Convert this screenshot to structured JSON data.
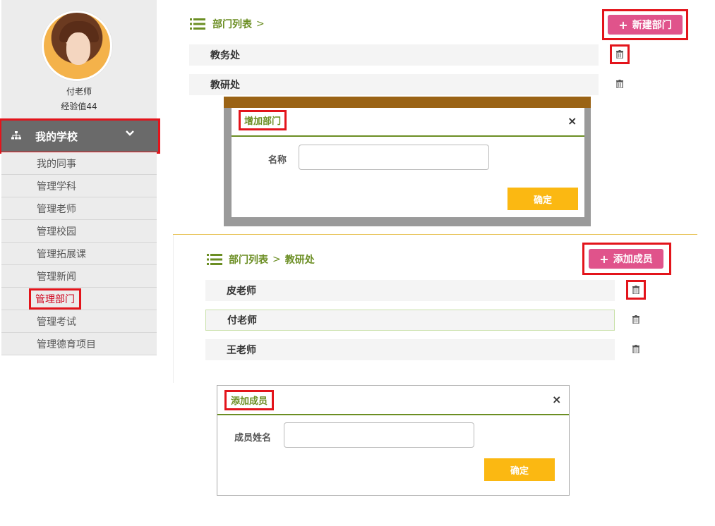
{
  "sidebar": {
    "teacher_name": "付老师",
    "experience": "经验值44",
    "school_menu": "我的学校",
    "items": [
      "我的同事",
      "管理学科",
      "管理老师",
      "管理校园",
      "管理拓展课",
      "管理新闻",
      "管理部门",
      "管理考试",
      "管理德育项目"
    ],
    "active_item": "管理部门"
  },
  "dept_panel": {
    "breadcrumb": "部门列表",
    "new_button": "新建部门",
    "departments": [
      "教务处",
      "教研处"
    ]
  },
  "add_dept_modal": {
    "title": "增加部门",
    "name_label": "名称",
    "name_value": "",
    "confirm": "确定",
    "close": "×"
  },
  "member_panel": {
    "breadcrumb_root": "部门列表",
    "breadcrumb_current": "教研处",
    "add_button": "添加成员",
    "members": [
      "皮老师",
      "付老师",
      "王老师"
    ]
  },
  "add_member_modal": {
    "title": "添加成员",
    "name_label": "成员姓名",
    "name_value": "",
    "confirm": "确定",
    "close": "×"
  },
  "colors": {
    "accent_green": "#6b8e23",
    "pink_button": "#e0538b",
    "yellow_button": "#fbb812",
    "highlight_red": "#e3141b"
  },
  "icons": [
    "list-icon",
    "plus-icon",
    "trash-icon",
    "close-icon",
    "chevron-down-icon",
    "org-tree-icon"
  ]
}
